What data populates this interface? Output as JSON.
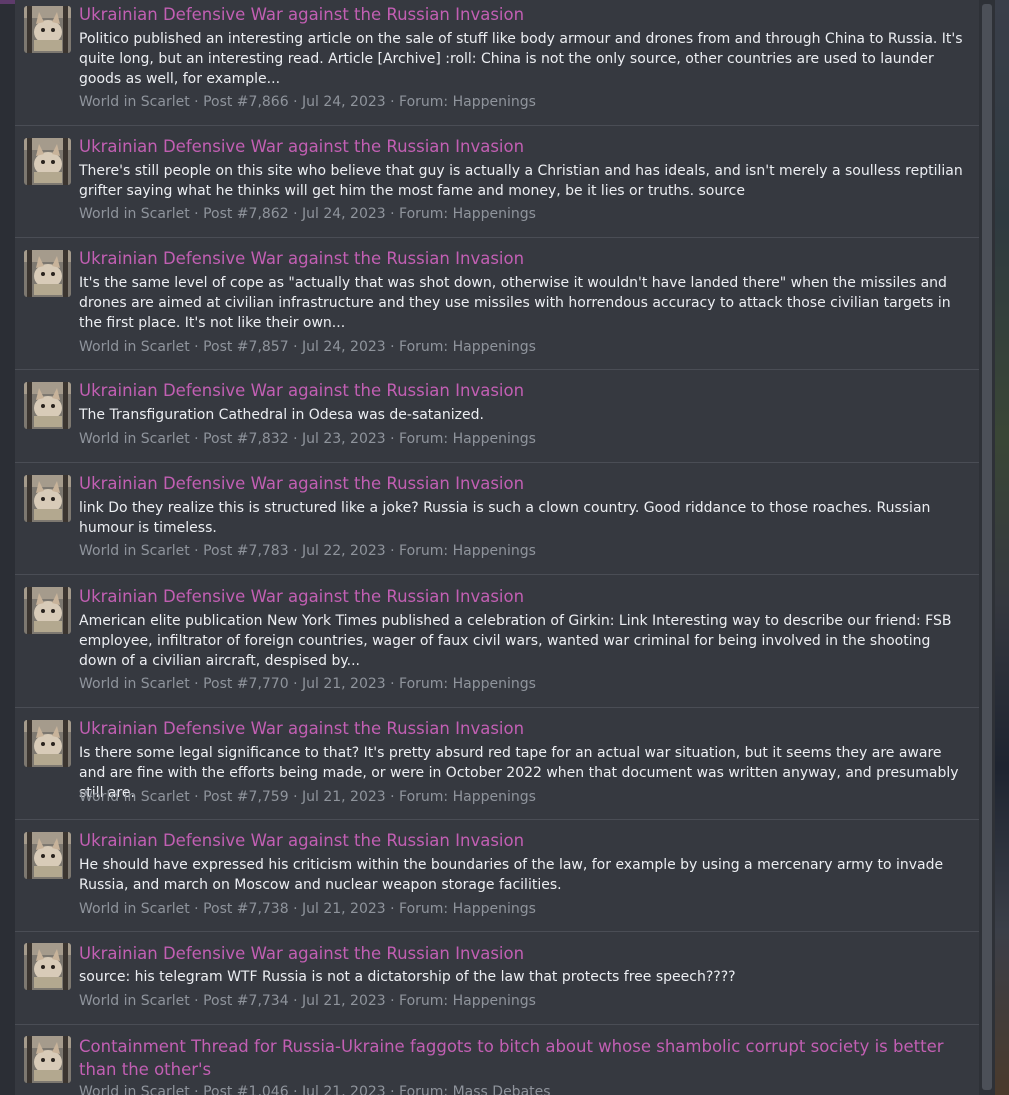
{
  "results": [
    {
      "title": "Ukrainian Defensive War against the Russian Invasion",
      "snippet": "Politico published an interesting article on the sale of stuff like body armour and drones from and through China to Russia. It's quite long, but an interesting read. Article [Archive] :roll: China is not the only source, other countries are used to launder goods as well, for example...",
      "author": "World in Scarlet",
      "post": "Post #7,866",
      "date": "Jul 24, 2023",
      "forum_label": "Forum:",
      "forum": "Happenings"
    },
    {
      "title": "Ukrainian Defensive War against the Russian Invasion",
      "snippet": "There's still people on this site who believe that guy is actually a Christian and has ideals, and isn't merely a soulless reptilian grifter saying what he thinks will get him the most fame and money, be it lies or truths. source",
      "author": "World in Scarlet",
      "post": "Post #7,862",
      "date": "Jul 24, 2023",
      "forum_label": "Forum:",
      "forum": "Happenings"
    },
    {
      "title": "Ukrainian Defensive War against the Russian Invasion",
      "snippet": "It's the same level of cope as \"actually that was shot down, otherwise it wouldn't have landed there\" when the missiles and drones are aimed at civilian infrastructure and they use missiles with horrendous accuracy to attack those civilian targets in the first place. It's not like their own...",
      "author": "World in Scarlet",
      "post": "Post #7,857",
      "date": "Jul 24, 2023",
      "forum_label": "Forum:",
      "forum": "Happenings"
    },
    {
      "title": "Ukrainian Defensive War against the Russian Invasion",
      "snippet": "The Transfiguration Cathedral in Odesa was de-satanized.",
      "author": "World in Scarlet",
      "post": "Post #7,832",
      "date": "Jul 23, 2023",
      "forum_label": "Forum:",
      "forum": "Happenings"
    },
    {
      "title": "Ukrainian Defensive War against the Russian Invasion",
      "snippet": "link Do they realize this is structured like a joke? Russia is such a clown country. Good riddance to those roaches. Russian humour is timeless.",
      "author": "World in Scarlet",
      "post": "Post #7,783",
      "date": "Jul 22, 2023",
      "forum_label": "Forum:",
      "forum": "Happenings"
    },
    {
      "title": "Ukrainian Defensive War against the Russian Invasion",
      "snippet": "American elite publication New York Times published a celebration of Girkin: Link Interesting way to describe our friend: FSB employee, infiltrator of foreign countries, wager of faux civil wars, wanted war criminal for being involved in the shooting down of a civilian aircraft, despised by...",
      "author": "World in Scarlet",
      "post": "Post #7,770",
      "date": "Jul 21, 2023",
      "forum_label": "Forum:",
      "forum": "Happenings"
    },
    {
      "title": "Ukrainian Defensive War against the Russian Invasion",
      "snippet": "Is there some legal significance to that? It's pretty absurd red tape for an actual war situation, but it seems they are aware and are fine with the efforts being made, or were in October 2022 when that document was written anyway, and presumably still are.",
      "author": "World in Scarlet",
      "post": "Post #7,759",
      "date": "Jul 21, 2023",
      "forum_label": "Forum:",
      "forum": "Happenings"
    },
    {
      "title": "Ukrainian Defensive War against the Russian Invasion",
      "snippet": "He should have expressed his criticism within the boundaries of the law, for example by using a mercenary army to invade Russia, and march on Moscow and nuclear weapon storage facilities.",
      "author": "World in Scarlet",
      "post": "Post #7,738",
      "date": "Jul 21, 2023",
      "forum_label": "Forum:",
      "forum": "Happenings"
    },
    {
      "title": "Ukrainian Defensive War against the Russian Invasion",
      "snippet": "source: his telegram WTF Russia is not a dictatorship of the law that protects free speech????",
      "author": "World in Scarlet",
      "post": "Post #7,734",
      "date": "Jul 21, 2023",
      "forum_label": "Forum:",
      "forum": "Happenings"
    },
    {
      "title": "Containment Thread for Russia-Ukraine faggots to bitch about whose shambolic corrupt society is better than the other's",
      "snippet": "",
      "author": "World in Scarlet",
      "post": "Post #1,046",
      "date": "Jul 21, 2023",
      "forum_label": "Forum:",
      "forum": "Mass Debates"
    }
  ],
  "separator": "·",
  "colors": {
    "title_link": "#c25fb3",
    "body_text": "#eceef2",
    "meta_text": "#8f949c",
    "panel_bg": "#363940"
  }
}
